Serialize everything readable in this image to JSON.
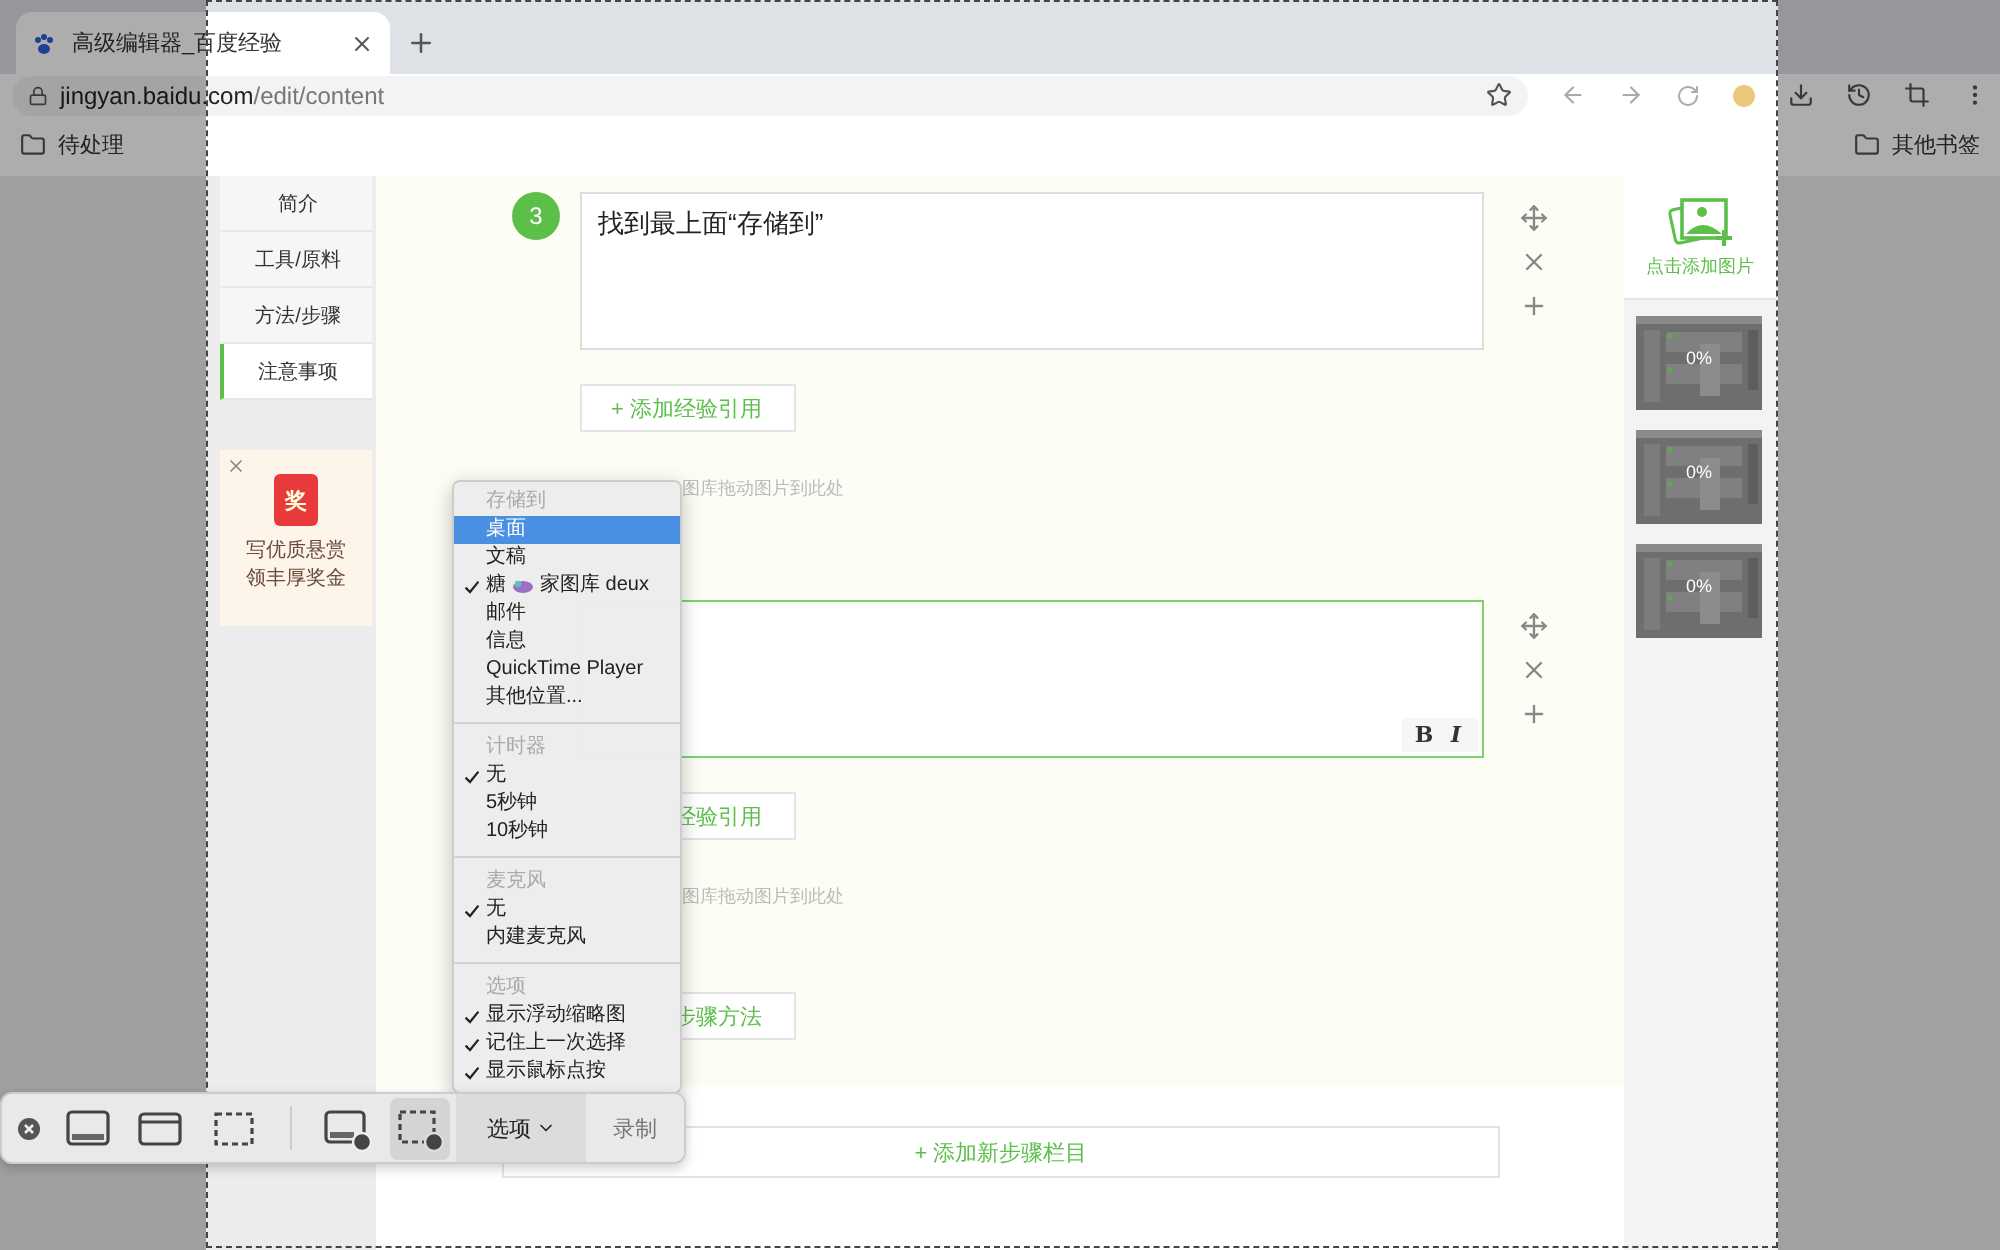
{
  "browser": {
    "tab_title": "高级编辑器_百度经验",
    "url_domain": "jingyan.baidu.com",
    "url_path": "/edit/content",
    "bookmarks": [
      {
        "label": "待处理"
      },
      {
        "label": "其他书签"
      }
    ]
  },
  "nav": [
    {
      "label": "简介",
      "selected": false
    },
    {
      "label": "工具/原料",
      "selected": false
    },
    {
      "label": "方法/步骤",
      "selected": false
    },
    {
      "label": "注意事项",
      "selected": true
    }
  ],
  "promo": {
    "badge": "奖",
    "lines": [
      "写优质悬赏",
      "领丰厚奖金"
    ]
  },
  "steps": [
    {
      "number": "3",
      "text": "找到最上面“存储到”",
      "focused": false,
      "ref_button": "+ 添加经验引用",
      "drop_hint": "图库拖动图片到此处"
    },
    {
      "focused": true,
      "format_buttons": [
        "B",
        "I"
      ],
      "ref_button": "经验引用",
      "drop_hint": "图库拖动图片到此处"
    }
  ],
  "method_button": "步骤方法",
  "add_step_button": "+ 添加新步骤栏目",
  "image_panel": {
    "add_label": "点击添加图片",
    "thumbnails": [
      {
        "caption": "0%"
      },
      {
        "caption": "0%"
      },
      {
        "caption": "0%"
      }
    ]
  },
  "save_menu": [
    {
      "header": "存储到",
      "items": [
        {
          "label": "桌面",
          "checked": false,
          "selected": true
        },
        {
          "label": "文稿",
          "checked": false,
          "selected": false
        },
        {
          "label": "糖",
          "suffix": "家图库 deux",
          "checked": true,
          "selected": false
        },
        {
          "label": "邮件",
          "checked": false,
          "selected": false
        },
        {
          "label": "信息",
          "checked": false,
          "selected": false
        },
        {
          "label": "QuickTime Player",
          "checked": false,
          "selected": false
        },
        {
          "label": "其他位置...",
          "checked": false,
          "selected": false
        }
      ]
    },
    {
      "header": "计时器",
      "items": [
        {
          "label": "无",
          "checked": true,
          "selected": false
        },
        {
          "label": "5秒钟",
          "checked": false,
          "selected": false
        },
        {
          "label": "10秒钟",
          "checked": false,
          "selected": false
        }
      ]
    },
    {
      "header": "麦克风",
      "items": [
        {
          "label": "无",
          "checked": true,
          "selected": false
        },
        {
          "label": "内建麦克风",
          "checked": false,
          "selected": false
        }
      ]
    },
    {
      "header": "选项",
      "items": [
        {
          "label": "显示浮动缩略图",
          "checked": true,
          "selected": false
        },
        {
          "label": "记住上一次选择",
          "checked": true,
          "selected": false
        },
        {
          "label": "显示鼠标点按",
          "checked": true,
          "selected": false
        }
      ]
    }
  ],
  "capture_toolbar": {
    "tools": [
      {
        "kind": "screen",
        "selected": false
      },
      {
        "kind": "window",
        "selected": false
      },
      {
        "kind": "selection",
        "selected": false
      },
      {
        "kind": "record-screen",
        "selected": false
      },
      {
        "kind": "record-selection",
        "selected": true
      }
    ],
    "options_button": "选项",
    "record_button": "录制"
  }
}
